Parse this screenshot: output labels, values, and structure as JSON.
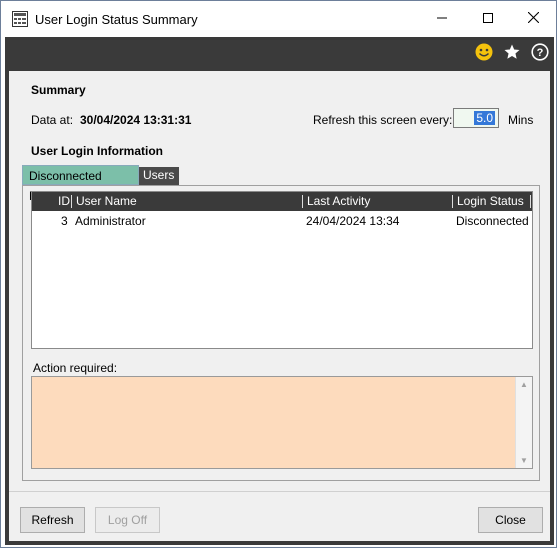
{
  "window": {
    "title": "User Login Status Summary",
    "icons": [
      "app-icon",
      "minimize-icon",
      "maximize-icon",
      "close-icon"
    ]
  },
  "toolbar": {
    "icons": [
      "smiley-icon",
      "star-icon",
      "help-icon"
    ]
  },
  "summary": {
    "heading": "Summary",
    "data_at_label": "Data at:",
    "data_at_value": "30/04/2024 13:31:31",
    "refresh_label": "Refresh this screen every:",
    "refresh_value": "5.0",
    "refresh_unit": "Mins"
  },
  "user_login": {
    "heading": "User Login Information",
    "tabs": [
      {
        "label": "Disconnected Logins",
        "active": true
      },
      {
        "label": "Users",
        "active": false
      }
    ],
    "columns": [
      "ID",
      "User Name",
      "Last Activity",
      "Login Status"
    ],
    "rows": [
      {
        "id": "3",
        "user_name": "Administrator",
        "last_activity": "24/04/2024 13:34",
        "login_status": "Disconnected"
      }
    ],
    "action_label": "Action required:",
    "action_text": ""
  },
  "buttons": {
    "refresh": "Refresh",
    "log_off": "Log Off",
    "close": "Close"
  },
  "colors": {
    "toolbar_bg": "#3a3a3a",
    "active_tab": "#7cbfa9",
    "action_bg": "#fddbbd",
    "smiley": "#f4c20d"
  }
}
